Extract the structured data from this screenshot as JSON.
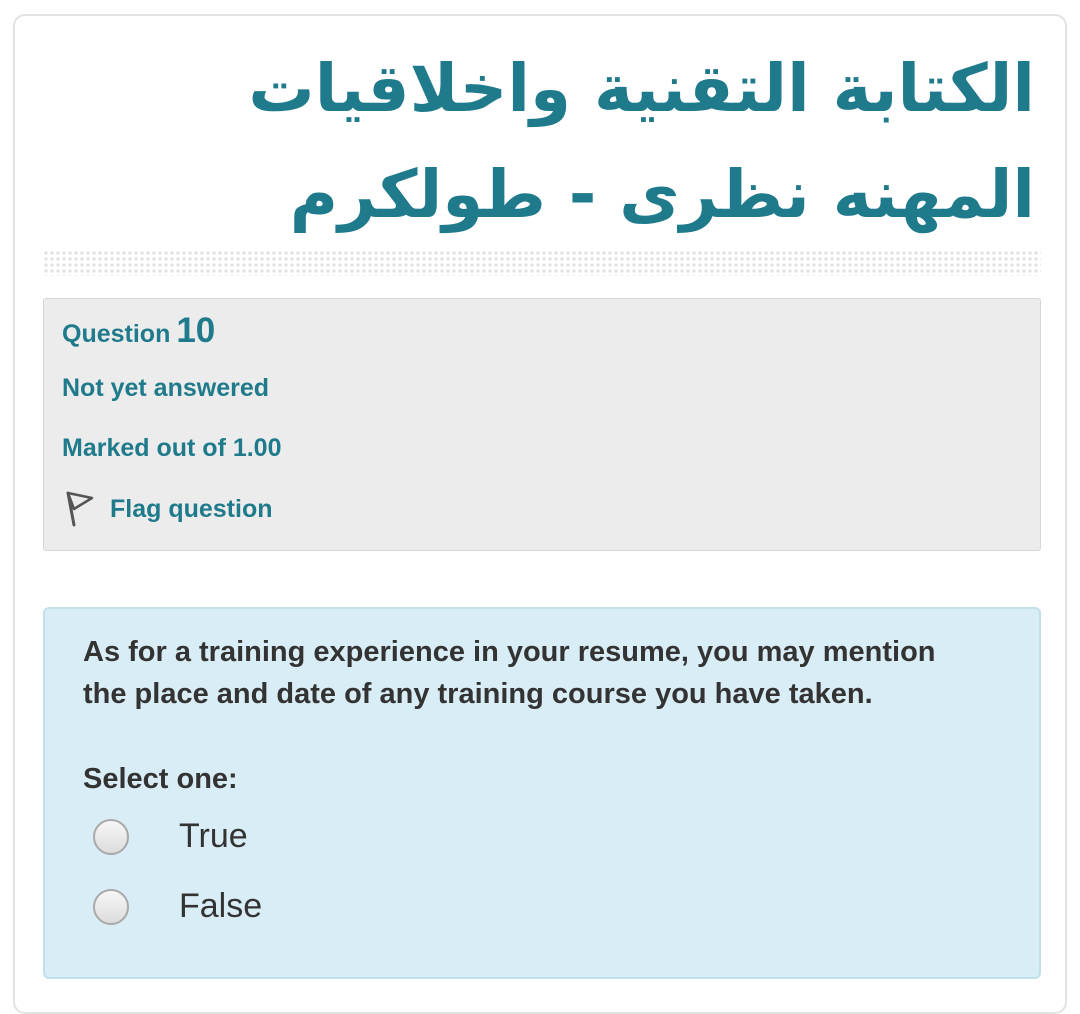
{
  "course": {
    "title": "الكتابة التقنية واخلاقيات المهنه نظرى - طولكرم"
  },
  "question_info": {
    "label": "Question",
    "number": "10",
    "state": "Not yet answered",
    "grade": "Marked out of 1.00",
    "flag_label": "Flag question"
  },
  "question": {
    "text": "As for a training experience in your resume, you may mention the place and date of any training course you have taken.",
    "prompt": "Select one:",
    "options": [
      {
        "label": "True",
        "selected": false
      },
      {
        "label": "False",
        "selected": false
      }
    ]
  },
  "colors": {
    "accent": "#1f7a8c",
    "info_bg": "#ececec",
    "content_bg": "#d9edf6"
  },
  "icons": {
    "flag": "flag-icon",
    "radio": "radio-button"
  }
}
